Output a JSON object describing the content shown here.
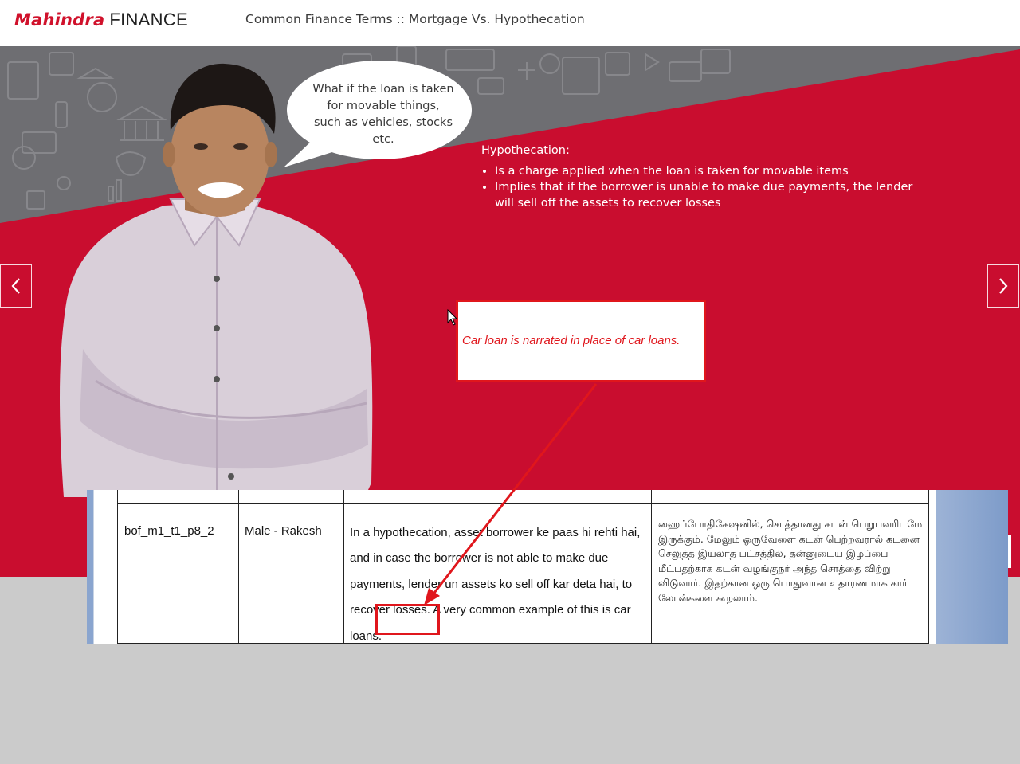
{
  "header": {
    "brand_name": "Mahindra",
    "brand_suffix": "FINANCE",
    "page_title": "Common Finance Terms :: Mortgage Vs. Hypothecation"
  },
  "slide": {
    "speech_bubble": "What if the loan is taken for movable things, such as vehicles, stocks etc.",
    "hypothecation": {
      "title": "Hypothecation:",
      "points": [
        "Is a charge applied when the loan is taken for movable items",
        "Implies that if the borrower is unable to make due payments, the lender will sell off the assets to recover losses"
      ]
    },
    "nav": {
      "prev_icon": "chevron-left-icon",
      "next_icon": "chevron-right-icon"
    }
  },
  "script_table": {
    "row": {
      "id": "bof_m1_t1_p8_2",
      "speaker": "Male - Rakesh",
      "english": "In a hypothecation, asset borrower ke paas hi rehti hai, and in case the borrower is not able to make due payments, lender un assets ko sell off kar deta hai, to recover losses. A very common example of this is car loans.",
      "tamil": "ஹைப்போதிகேஷனில், சொத்தானது கடன் பெறுபவரிடமே இருக்கும். மேலும் ஒருவேளை கடன் பெற்றவரால் கடனை செலுத்த இயலாத பட்சத்தில், தன்னுடைய இழப்பை மீட்பதற்காக கடன் வழங்குநர் அந்த சொத்தை விற்று விடுவார். இதற்கான ஒரு பொதுவான உதாரணமாக கார் லோன்களை கூறலாம்."
    }
  },
  "annotation": {
    "comment": "Car loan is narrated in place of car loans.",
    "color": "#e0161c"
  },
  "colors": {
    "brand_red": "#d0112b",
    "slide_red": "#c90d2f",
    "gray_band": "#6e6e72"
  }
}
